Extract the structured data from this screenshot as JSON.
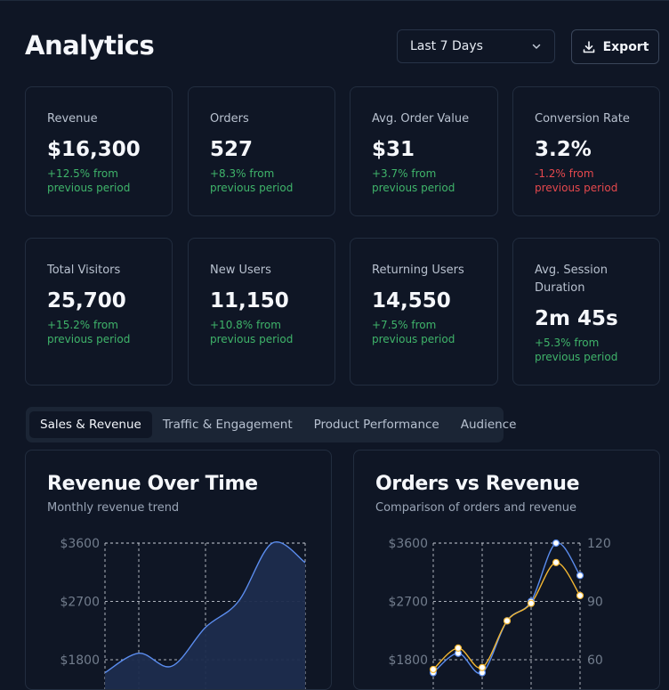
{
  "header": {
    "title": "Analytics",
    "range_selected": "Last 7 Days",
    "export_label": "Export"
  },
  "metrics": [
    {
      "label": "Revenue",
      "value": "$16,300",
      "delta": "+12.5% from previous period",
      "trend": "up"
    },
    {
      "label": "Orders",
      "value": "527",
      "delta": "+8.3% from previous period",
      "trend": "up"
    },
    {
      "label": "Avg. Order Value",
      "value": "$31",
      "delta": "+3.7% from previous period",
      "trend": "up"
    },
    {
      "label": "Conversion Rate",
      "value": "3.2%",
      "delta": "-1.2% from previous period",
      "trend": "down"
    },
    {
      "label": "Total Visitors",
      "value": "25,700",
      "delta": "+15.2% from previous period",
      "trend": "up"
    },
    {
      "label": "New Users",
      "value": "11,150",
      "delta": "+10.8% from previous period",
      "trend": "up"
    },
    {
      "label": "Returning Users",
      "value": "14,550",
      "delta": "+7.5% from previous period",
      "trend": "up"
    },
    {
      "label": "Avg. Session Duration",
      "value": "2m 45s",
      "delta": "+5.3% from previous period",
      "trend": "up"
    }
  ],
  "tabs": [
    {
      "label": "Sales & Revenue",
      "active": true
    },
    {
      "label": "Traffic & Engagement",
      "active": false
    },
    {
      "label": "Product Performance",
      "active": false
    },
    {
      "label": "Audience",
      "active": false
    }
  ],
  "colors": {
    "background": "#0f1625",
    "positive": "#3fb46a",
    "negative": "#e5484d",
    "revenue_line": "#5b8def",
    "orders_line": "#f2b632"
  },
  "chart_data": [
    {
      "type": "area",
      "title": "Revenue Over Time",
      "subtitle": "Monthly revenue trend",
      "ylim": [
        1500,
        3750
      ],
      "y_ticks": [
        "$3600",
        "$2700",
        "$1800"
      ],
      "grid": true,
      "series": [
        {
          "values": [
            1600,
            1900,
            1700,
            2300,
            2700,
            3600,
            3300
          ]
        }
      ]
    },
    {
      "type": "line",
      "title": "Orders vs Revenue",
      "subtitle": "Comparison of orders and revenue",
      "ylim": [
        1500,
        3750
      ],
      "y_ticks": [
        "$3600",
        "$2700",
        "$1800"
      ],
      "y2lim": [
        50,
        125
      ],
      "y2_ticks": [
        "120",
        "90",
        "60"
      ],
      "grid": true,
      "series": [
        {
          "axis": "left",
          "values": [
            1600,
            1900,
            1600,
            2400,
            2700,
            3600,
            3100
          ]
        },
        {
          "axis": "right",
          "values": [
            55,
            66,
            56,
            80,
            89,
            110,
            93
          ]
        }
      ]
    }
  ]
}
